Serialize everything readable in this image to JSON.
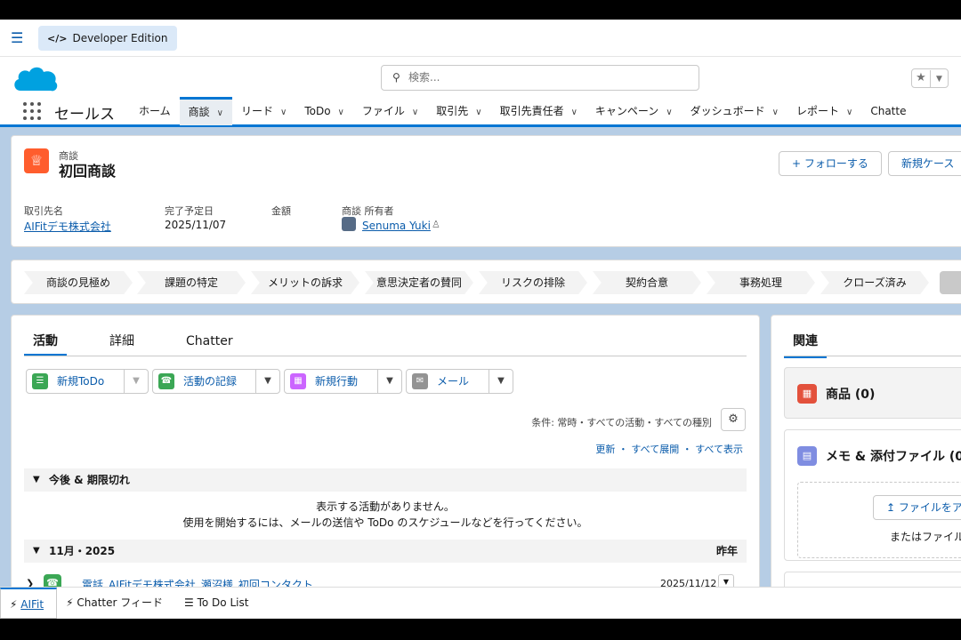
{
  "topbar": {
    "edition": "Developer Edition",
    "edition_icon": "code-icon"
  },
  "header": {
    "search_placeholder": "検索...",
    "app_name": "セールス",
    "nav_tabs": [
      {
        "label": "ホーム",
        "has_menu": false
      },
      {
        "label": "商談",
        "has_menu": true,
        "active": true
      },
      {
        "label": "リード",
        "has_menu": true
      },
      {
        "label": "ToDo",
        "has_menu": true
      },
      {
        "label": "ファイル",
        "has_menu": true
      },
      {
        "label": "取引先",
        "has_menu": true
      },
      {
        "label": "取引先責任者",
        "has_menu": true
      },
      {
        "label": "キャンペーン",
        "has_menu": true
      },
      {
        "label": "ダッシュボード",
        "has_menu": true
      },
      {
        "label": "レポート",
        "has_menu": true
      },
      {
        "label": "Chatte",
        "has_menu": false
      }
    ]
  },
  "record": {
    "type_label": "商談",
    "title": "初回商談",
    "follow_button": "+ フォローする",
    "new_case_button": "新規ケース",
    "fields": [
      {
        "label": "取引先名",
        "value": "AIFitデモ株式会社",
        "link": true
      },
      {
        "label": "完了予定日",
        "value": "2025/11/07",
        "link": false
      },
      {
        "label": "金額",
        "value": "",
        "link": false
      },
      {
        "label": "商談 所有者",
        "value": "Senuma Yuki",
        "link": true
      }
    ]
  },
  "path": {
    "stages": [
      "商談の見極め",
      "課題の特定",
      "メリットの訴求",
      "意思決定者の賛同",
      "リスクの排除",
      "契約合意",
      "事務処理",
      "クローズ済み"
    ]
  },
  "activity": {
    "tabs": [
      "活動",
      "詳細",
      "Chatter"
    ],
    "publisher": [
      {
        "label": "新規ToDo",
        "color": "#3ba755",
        "icon": "todo-icon"
      },
      {
        "label": "活動の記録",
        "color": "#3ba755",
        "icon": "phone-icon"
      },
      {
        "label": "新規行動",
        "color": "#cb65ff",
        "icon": "calendar-icon"
      },
      {
        "label": "メール",
        "color": "#939393",
        "icon": "email-icon"
      }
    ],
    "filter_text": "条件: 常時・すべての活動・すべての種別",
    "links": [
      "更新",
      "すべて展開",
      "すべて表示"
    ],
    "section_upcoming": "今後 & 期限切れ",
    "empty_line1": "表示する活動がありません。",
    "empty_line2": "使用を開始するには、メールの送信や ToDo のスケジュールなどを行ってください。",
    "section_month": "11月・2025",
    "section_month_right": "昨年",
    "item_title": "電話_AIFitデモ株式会社_瀬沼様_初回コンタクト",
    "item_date": "2025/11/12"
  },
  "related": {
    "tab": "関連",
    "products": "商品 (0)",
    "files": "メモ & 添付ファイル (0",
    "upload_button": "ファイルをア",
    "drop_text": "またはファイル"
  },
  "utility": [
    {
      "label": "AIFit",
      "icon": "bolt-icon"
    },
    {
      "label": "Chatter フィード",
      "icon": "bolt-icon"
    },
    {
      "label": "To Do List",
      "icon": "list-icon"
    }
  ]
}
